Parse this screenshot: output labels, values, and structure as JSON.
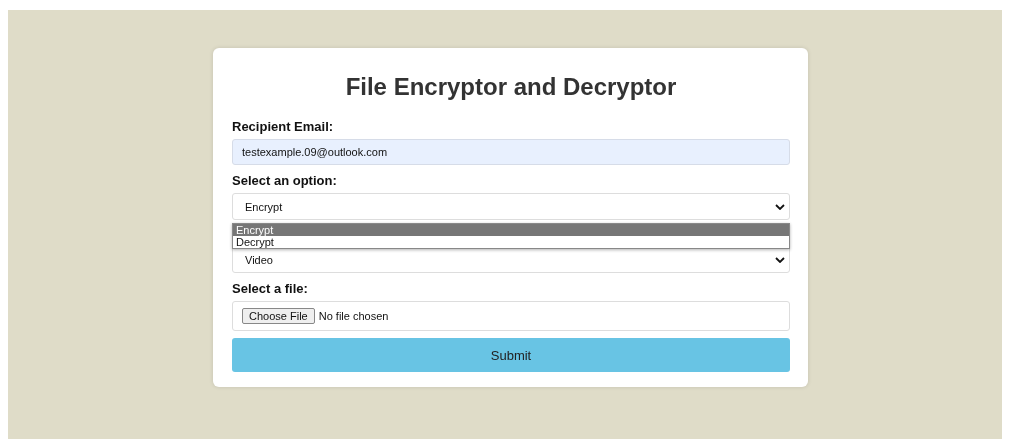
{
  "title": "File Encryptor and Decryptor",
  "email": {
    "label": "Recipient Email:",
    "value": "testexample.09@outlook.com"
  },
  "option_select": {
    "label": "Select an option:",
    "value": "Encrypt",
    "open": true,
    "options": [
      {
        "label": "Encrypt",
        "selected": true
      },
      {
        "label": "Decrypt",
        "selected": false
      }
    ]
  },
  "type_select": {
    "value": "Video"
  },
  "file": {
    "label": "Select a file:",
    "button": "Choose File",
    "status": "No file chosen"
  },
  "submit": "Submit"
}
